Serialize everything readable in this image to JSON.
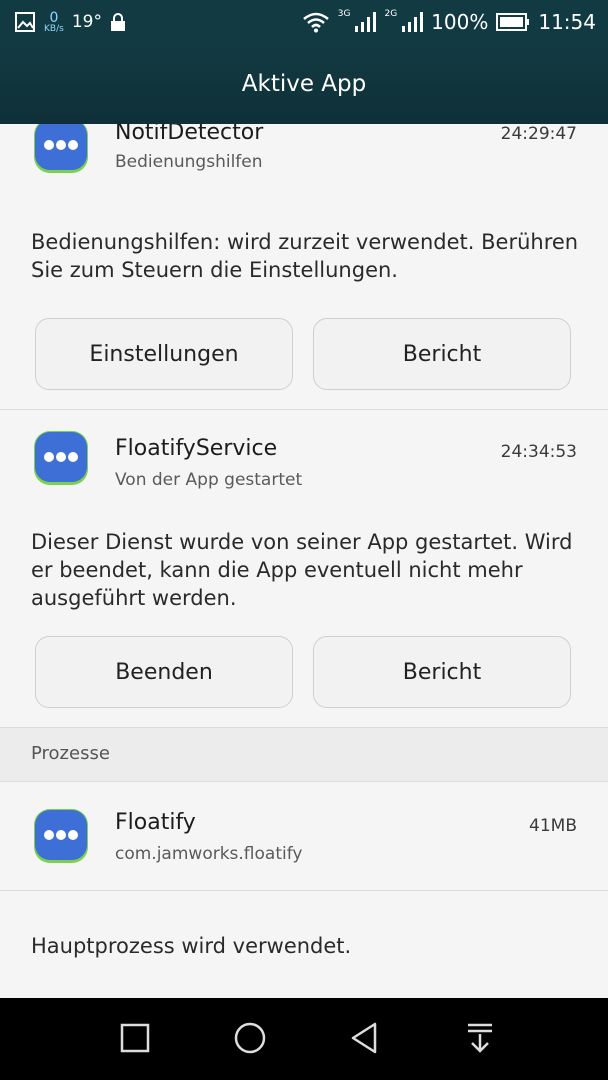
{
  "status_bar": {
    "speed_value": "0",
    "speed_unit": "KB/s",
    "temperature": "19°",
    "net_3g": "3G",
    "net_2g": "2G",
    "battery_percent": "100%",
    "time": "11:54",
    "icons": [
      "image-icon",
      "lock-icon",
      "wifi-icon",
      "signal-icon",
      "battery-icon"
    ]
  },
  "title_bar": {
    "title": "Aktive App"
  },
  "services": [
    {
      "name": "NotifDetector",
      "subtitle": "Bedienungshilfen",
      "time": "24:29:47",
      "description": "Bedienungshilfen: wird zurzeit verwendet. Berühren Sie zum Steuern die Einstellungen.",
      "button_left": "Einstellungen",
      "button_right": "Bericht"
    },
    {
      "name": "FloatifyService",
      "subtitle": "Von der App gestartet",
      "time": "24:34:53",
      "description": "Dieser Dienst wurde von seiner App gestartet. Wird er beendet, kann die App eventuell nicht mehr ausgeführt werden.",
      "button_left": "Beenden",
      "button_right": "Bericht"
    }
  ],
  "processes": {
    "header": "Prozesse",
    "items": [
      {
        "name": "Floatify",
        "package": "com.jamworks.floatify",
        "size": "41MB",
        "description": "Hauptprozess wird verwendet."
      }
    ]
  },
  "nav_bar": {
    "icons": [
      "recent-apps-icon",
      "home-icon",
      "back-icon",
      "notification-pulldown-icon"
    ]
  },
  "colors": {
    "header": "#123a42",
    "icon_blue": "#3d6fd6",
    "icon_ring": "#7bd24a"
  }
}
